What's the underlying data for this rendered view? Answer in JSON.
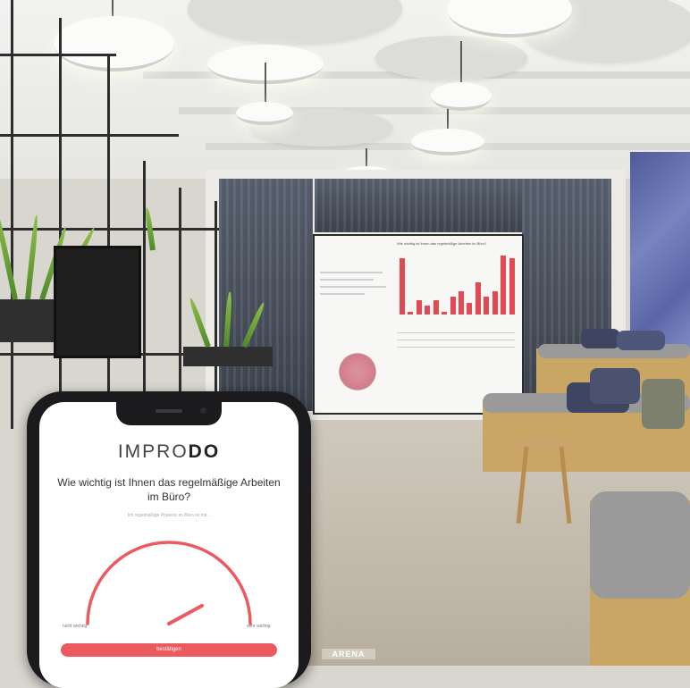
{
  "brand": {
    "logo_main": "IMPRO",
    "logo_accent": "DO"
  },
  "survey": {
    "question": "Wie wichtig ist Ihnen das regelmäßige Arbeiten im Büro?",
    "hint": "Ich regelmäßige Präsenz im Büro ist mir...",
    "scale_low": "nicht wichtig",
    "scale_high": "sehr wichtig",
    "submit_label": "bestätigen",
    "gauge_value": 0.72
  },
  "wall_screen": {
    "title": "Wie wichtig ist Ihnen das regelmäßige Arbeiten im Büro?",
    "bar_values": [
      0.95,
      0.05,
      0.25,
      0.15,
      0.25,
      0.05,
      0.3,
      0.4,
      0.2,
      0.55,
      0.3,
      0.4,
      1.0,
      0.95
    ]
  },
  "watermark": {
    "text": "ARENA"
  },
  "colors": {
    "accent": "#ea5a5f",
    "phone_body": "#1b1b1d"
  }
}
